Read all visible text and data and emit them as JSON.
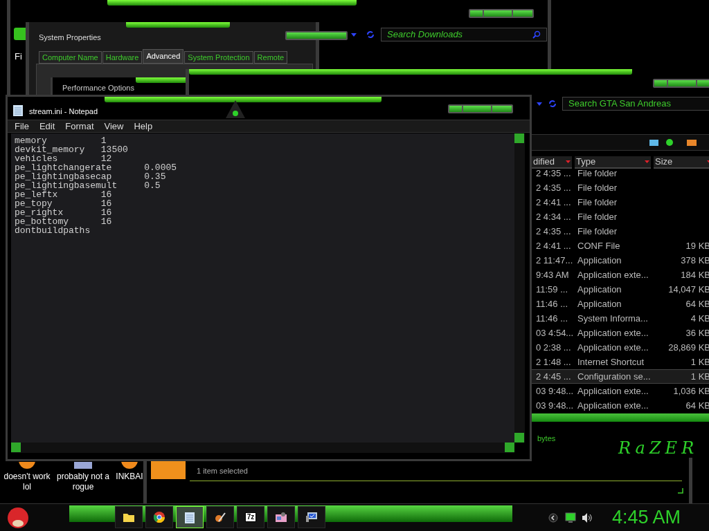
{
  "downloads_window": {
    "menu_partial": "Fi",
    "search_placeholder": "Search Downloads"
  },
  "system_properties": {
    "title": "System Properties",
    "tabs": [
      {
        "label": "Computer Name",
        "selected": false
      },
      {
        "label": "Hardware",
        "selected": false
      },
      {
        "label": "Advanced",
        "selected": true
      },
      {
        "label": "System Protection",
        "selected": false
      },
      {
        "label": "Remote",
        "selected": false
      }
    ]
  },
  "performance_options": {
    "title": "Performance Options"
  },
  "details_pane": {
    "status": "1 item selected"
  },
  "explorer": {
    "search_placeholder": "Search GTA San Andreas",
    "columns": [
      "dified",
      "Type",
      "Size"
    ],
    "rows": [
      {
        "modified": "2 4:35 ...",
        "type": "File folder",
        "selected": false
      },
      {
        "modified": "2 4:35 ...",
        "type": "File folder",
        "selected": false
      },
      {
        "modified": "2 4:41 ...",
        "type": "File folder",
        "selected": false
      },
      {
        "modified": "2 4:34 ...",
        "type": "File folder",
        "selected": false
      },
      {
        "modified": "2 4:35 ...",
        "type": "File folder",
        "selected": false
      },
      {
        "modified": "2 4:41 ...",
        "type": "CONF File",
        "size": "19 KB",
        "selected": false
      },
      {
        "modified": "2 11:47...",
        "type": "Application",
        "size": "378 KB",
        "selected": false
      },
      {
        "modified": "9:43 AM",
        "type": "Application exte...",
        "size": "184 KB",
        "selected": false
      },
      {
        "modified": "11:59 ...",
        "type": "Application",
        "size": "14,047 KB",
        "selected": false
      },
      {
        "modified": "11:46 ...",
        "type": "Application",
        "size": "64 KB",
        "selected": false
      },
      {
        "modified": "11:46 ...",
        "type": "System Informa...",
        "size": "4 KB",
        "selected": false
      },
      {
        "modified": "03 4:54...",
        "type": "Application exte...",
        "size": "36 KB",
        "selected": false
      },
      {
        "modified": "0 2:38 ...",
        "type": "Application exte...",
        "size": "28,869 KB",
        "selected": false
      },
      {
        "modified": "2 1:48 ...",
        "type": "Internet Shortcut",
        "size": "1 KB",
        "selected": false
      },
      {
        "modified": "2 4:45 ...",
        "type": "Configuration se...",
        "size": "1 KB",
        "selected": true
      },
      {
        "modified": "03 9:48...",
        "type": "Application exte...",
        "size": "1,036 KB",
        "selected": false
      },
      {
        "modified": "03 9:48...",
        "type": "Application exte...",
        "size": "64 KB",
        "selected": false
      }
    ],
    "status_partial": "bytes",
    "logo": "RaZER"
  },
  "notepad": {
    "title": "stream.ini - Notepad",
    "menu": [
      "File",
      "Edit",
      "Format",
      "View",
      "Help"
    ],
    "lines": [
      "memory          1",
      "devkit_memory   13500",
      "vehicles        12",
      "pe_lightchangerate      0.0005",
      "pe_lightingbasecap      0.35",
      "pe_lightingbasemult     0.5",
      "pe_leftx        16",
      "pe_topy         16",
      "pe_rightx       16",
      "pe_bottomy      16",
      "dontbuildpaths"
    ]
  },
  "desktop_icons": [
    {
      "label": "doesn't work lol",
      "kind": "orange"
    },
    {
      "label": "probably not a rogue",
      "kind": "computer"
    },
    {
      "label": "INKBAI",
      "kind": "orange"
    }
  ],
  "taskbar": {
    "items": [
      {
        "kind": "folder",
        "selected": false
      },
      {
        "kind": "browser",
        "selected": false
      },
      {
        "kind": "notepad",
        "selected": true
      },
      {
        "kind": "paint",
        "selected": false
      },
      {
        "kind": "archive",
        "label": "7z",
        "selected": false
      },
      {
        "kind": "photos",
        "selected": false
      },
      {
        "kind": "monitor",
        "selected": false
      }
    ],
    "clock": "4:45 AM"
  }
}
